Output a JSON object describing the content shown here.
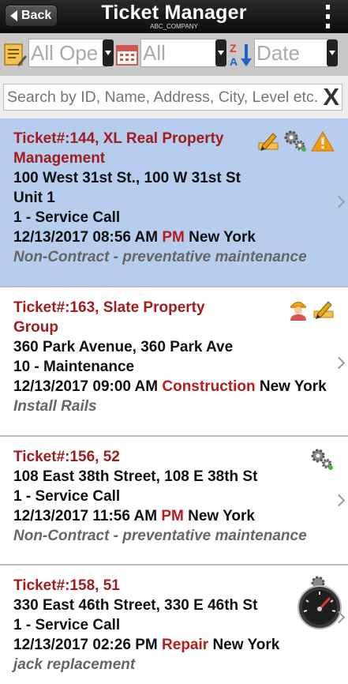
{
  "header": {
    "back_label": "Back",
    "title": "Ticket Manager",
    "subtitle": "ABC_COMPANY"
  },
  "filters": [
    {
      "icon": "notepad-pencil-icon",
      "value": "All Ope"
    },
    {
      "icon": "calendar-icon",
      "value": "All"
    },
    {
      "icon": "sort-az-icon",
      "value": "Date"
    }
  ],
  "search": {
    "placeholder": "Search by ID, Name, Address, City, Level etc.",
    "clear": "X"
  },
  "tickets": [
    {
      "title": "Ticket#:144, XL Real Property Management",
      "address": "100 West 31st St., 100 W 31st St",
      "unit": "Unit 1",
      "type": "1 - Service Call",
      "datetime": "12/13/2017 08:56 AM",
      "category": "PM",
      "city": "New York",
      "description": "Non-Contract - preventative maintenance",
      "icons": [
        "pencil-icon",
        "gears-icon",
        "warning-icon"
      ]
    },
    {
      "title": "Ticket#:163, Slate Property Group",
      "address": "360 Park Avenue, 360 Park Ave",
      "type": "10 - Maintenance",
      "datetime": "12/13/2017 09:00 AM",
      "category": "Construction",
      "city": "New York",
      "description": "Install Rails",
      "icons": [
        "worker-icon",
        "pencil-icon"
      ]
    },
    {
      "title": "Ticket#:156, 52",
      "address": "108 East 38th Street, 108 E 38th St",
      "type": "1 - Service Call",
      "datetime": "12/13/2017 11:56 AM",
      "category": "PM",
      "city": "New York",
      "description": "Non-Contract - preventative maintenance",
      "icons": [
        "gears-icon"
      ]
    },
    {
      "title": "Ticket#:158, 51",
      "address": "330 East 46th Street, 330 E 46th St",
      "type": "1 - Service Call",
      "datetime": "12/13/2017 02:26 PM",
      "category": "Repair",
      "city": "New York",
      "description": "jack replacement",
      "icons": [
        "gears-icon",
        "speedometer-icon"
      ]
    }
  ],
  "colors": {
    "header_bg": "#111111",
    "selected_bg": "#b6cdee",
    "title_red": "#a11d1d",
    "category_red": "#b71c1c"
  }
}
